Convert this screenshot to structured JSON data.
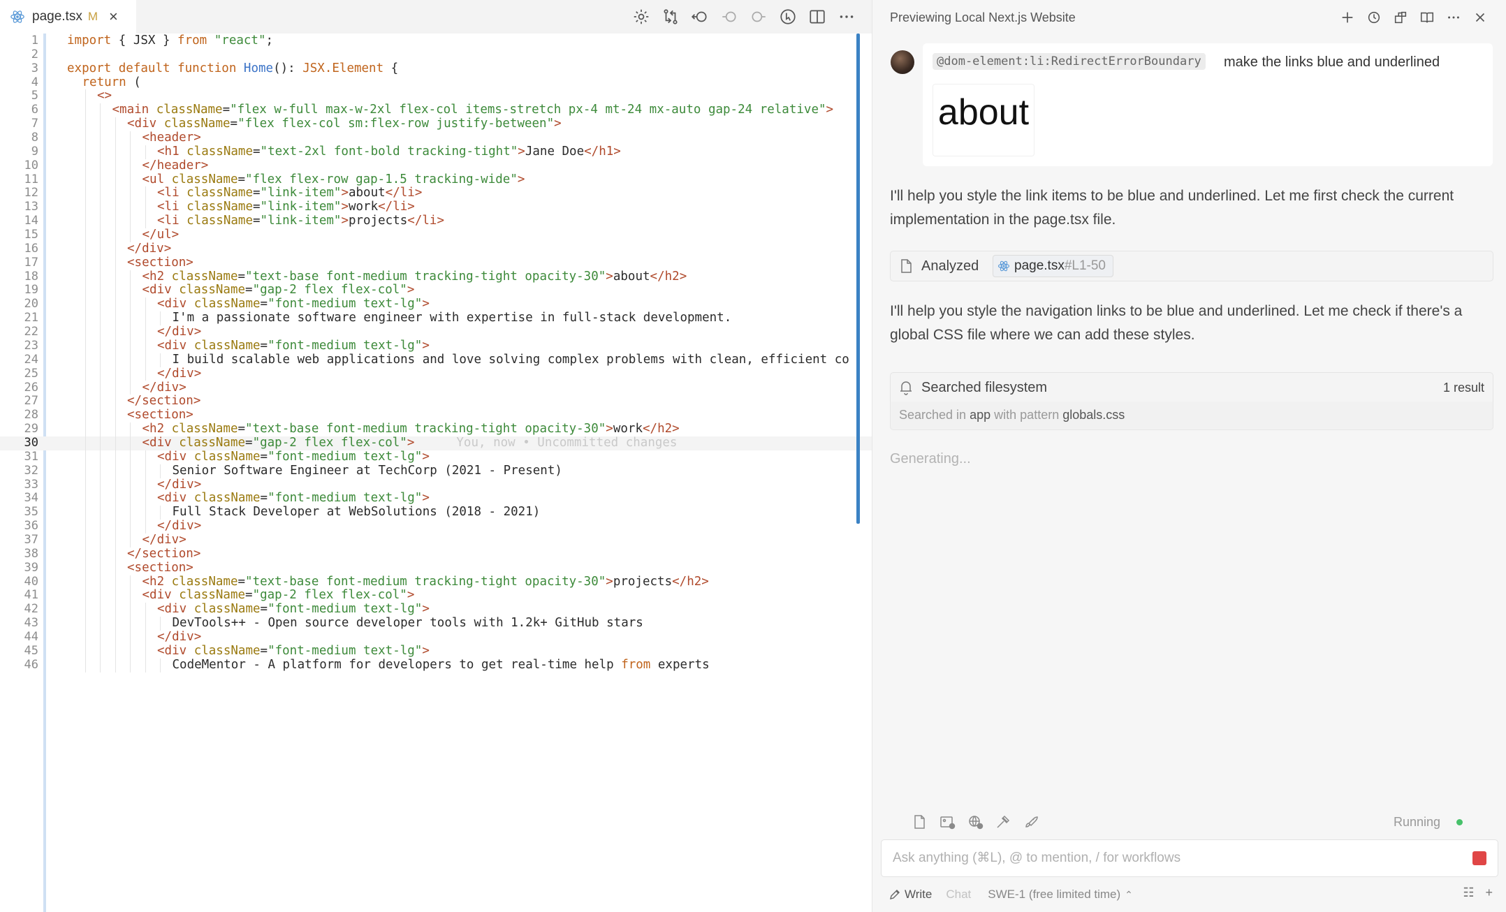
{
  "editor": {
    "tab": {
      "filename": "page.tsx",
      "modified": "M",
      "close": "×"
    },
    "active_line": 30,
    "blame": "You, now • Uncommitted changes",
    "lines": [
      {
        "n": "1",
        "i": 0,
        "t": "import { JSX } from \"react\";"
      },
      {
        "n": "2",
        "i": 0,
        "t": ""
      },
      {
        "n": "3",
        "i": 0,
        "t": "export default function Home(): JSX.Element {"
      },
      {
        "n": "4",
        "i": 1,
        "t": "return ("
      },
      {
        "n": "5",
        "i": 2,
        "t": "<>"
      },
      {
        "n": "6",
        "i": 3,
        "t": "<main className=\"flex w-full max-w-2xl flex-col items-stretch px-4 mt-24 mx-auto gap-24 relative\">"
      },
      {
        "n": "7",
        "i": 4,
        "t": "<div className=\"flex flex-col sm:flex-row justify-between\">"
      },
      {
        "n": "8",
        "i": 5,
        "t": "<header>"
      },
      {
        "n": "9",
        "i": 6,
        "t": "<h1 className=\"text-2xl font-bold tracking-tight\">Jane Doe</h1>"
      },
      {
        "n": "10",
        "i": 5,
        "t": "</header>"
      },
      {
        "n": "11",
        "i": 5,
        "t": "<ul className=\"flex flex-row gap-1.5 tracking-wide\">"
      },
      {
        "n": "12",
        "i": 6,
        "t": "<li className=\"link-item\">about</li>"
      },
      {
        "n": "13",
        "i": 6,
        "t": "<li className=\"link-item\">work</li>"
      },
      {
        "n": "14",
        "i": 6,
        "t": "<li className=\"link-item\">projects</li>"
      },
      {
        "n": "15",
        "i": 5,
        "t": "</ul>"
      },
      {
        "n": "16",
        "i": 4,
        "t": "</div>"
      },
      {
        "n": "17",
        "i": 4,
        "t": "<section>"
      },
      {
        "n": "18",
        "i": 5,
        "t": "<h2 className=\"text-base font-medium tracking-tight opacity-30\">about</h2>"
      },
      {
        "n": "19",
        "i": 5,
        "t": "<div className=\"gap-2 flex flex-col\">"
      },
      {
        "n": "20",
        "i": 6,
        "t": "<div className=\"font-medium text-lg\">"
      },
      {
        "n": "21",
        "i": 7,
        "t": "I'm a passionate software engineer with expertise in full-stack development."
      },
      {
        "n": "22",
        "i": 6,
        "t": "</div>"
      },
      {
        "n": "23",
        "i": 6,
        "t": "<div className=\"font-medium text-lg\">"
      },
      {
        "n": "24",
        "i": 7,
        "t": "I build scalable web applications and love solving complex problems with clean, efficient co"
      },
      {
        "n": "25",
        "i": 6,
        "t": "</div>"
      },
      {
        "n": "26",
        "i": 5,
        "t": "</div>"
      },
      {
        "n": "27",
        "i": 4,
        "t": "</section>"
      },
      {
        "n": "28",
        "i": 4,
        "t": "<section>"
      },
      {
        "n": "29",
        "i": 5,
        "t": "<h2 className=\"text-base font-medium tracking-tight opacity-30\">work</h2>"
      },
      {
        "n": "30",
        "i": 5,
        "t": "<div className=\"gap-2 flex flex-col\">"
      },
      {
        "n": "31",
        "i": 6,
        "t": "<div className=\"font-medium text-lg\">"
      },
      {
        "n": "32",
        "i": 7,
        "t": "Senior Software Engineer at TechCorp (2021 - Present)"
      },
      {
        "n": "33",
        "i": 6,
        "t": "</div>"
      },
      {
        "n": "34",
        "i": 6,
        "t": "<div className=\"font-medium text-lg\">"
      },
      {
        "n": "35",
        "i": 7,
        "t": "Full Stack Developer at WebSolutions (2018 - 2021)"
      },
      {
        "n": "36",
        "i": 6,
        "t": "</div>"
      },
      {
        "n": "37",
        "i": 5,
        "t": "</div>"
      },
      {
        "n": "38",
        "i": 4,
        "t": "</section>"
      },
      {
        "n": "39",
        "i": 4,
        "t": "<section>"
      },
      {
        "n": "40",
        "i": 5,
        "t": "<h2 className=\"text-base font-medium tracking-tight opacity-30\">projects</h2>"
      },
      {
        "n": "41",
        "i": 5,
        "t": "<div className=\"gap-2 flex flex-col\">"
      },
      {
        "n": "42",
        "i": 6,
        "t": "<div className=\"font-medium text-lg\">"
      },
      {
        "n": "43",
        "i": 7,
        "t": "DevTools++ - Open source developer tools with 1.2k+ GitHub stars"
      },
      {
        "n": "44",
        "i": 6,
        "t": "</div>"
      },
      {
        "n": "45",
        "i": 6,
        "t": "<div className=\"font-medium text-lg\">"
      },
      {
        "n": "46",
        "i": 7,
        "t": "CodeMentor - A platform for developers to get real-time help from experts"
      }
    ]
  },
  "panel": {
    "title": "Previewing Local Next.js Website",
    "user_message": {
      "mention": "@dom-element:li:RedirectErrorBoundary",
      "text": "make the links blue and underlined",
      "preview_text": "about"
    },
    "reply_1": "I'll help you style the link items to be blue and underlined. Let me first check the current implementation in the page.tsx file.",
    "analyzed": {
      "label": "Analyzed",
      "file": "page.tsx",
      "range": "#L1-50"
    },
    "reply_2": "I'll help you style the navigation links to be blue and underlined. Let me check if there's a global CSS file where we can add these styles.",
    "search": {
      "label": "Searched filesystem",
      "count": "1 result",
      "detail_prefix": "Searched in",
      "detail_dir": "app",
      "detail_mid": "with pattern",
      "detail_pattern": "globals.css"
    },
    "generating": "Generating...",
    "status": "Running",
    "input_placeholder": "Ask anything (⌘L), @ to mention, / for workflows",
    "mode_write": "Write",
    "mode_chat": "Chat",
    "model": "SWE-1 (free limited time)"
  },
  "colors": {
    "keyword": "#c0641c",
    "function": "#3b73c7",
    "string": "#3d8a3a",
    "tag": "#b04a2c",
    "attr": "#9a7a10",
    "accent": "#3b82c4",
    "stop": "#e04646",
    "running": "#47c16a"
  }
}
